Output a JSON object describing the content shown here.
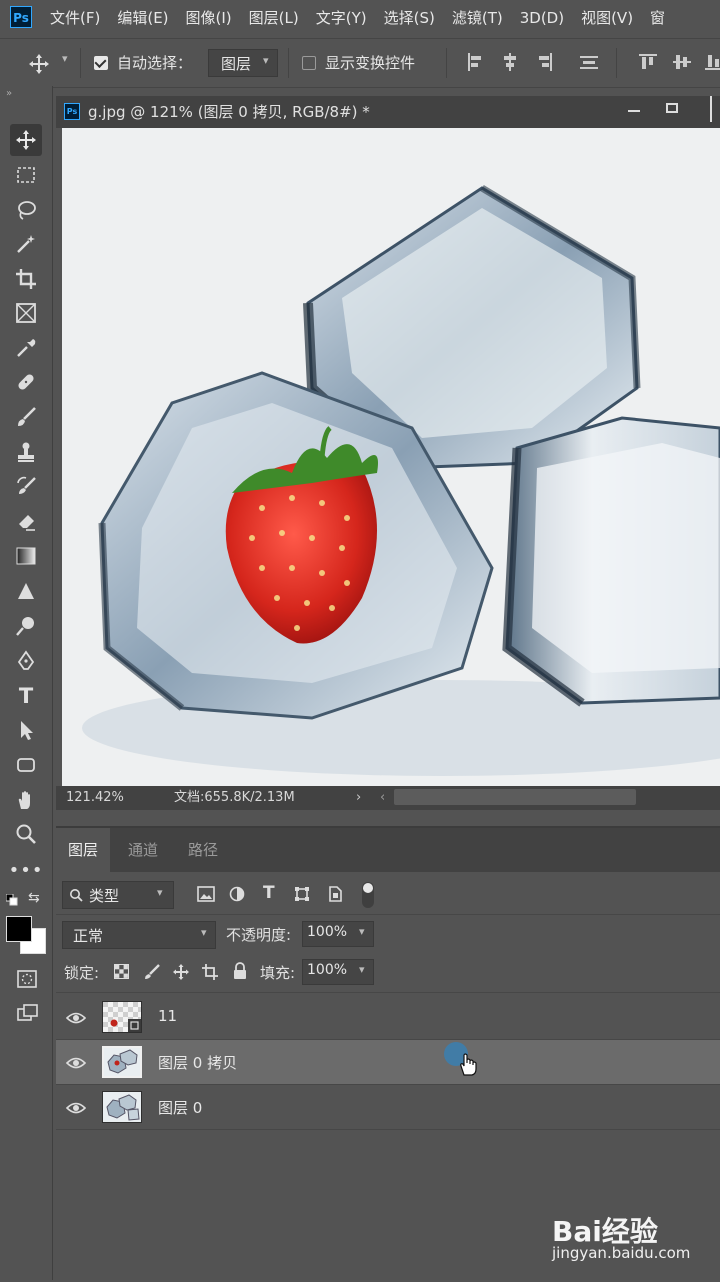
{
  "app": {
    "logo": "Ps"
  },
  "menu": [
    "文件(F)",
    "编辑(E)",
    "图像(I)",
    "图层(L)",
    "文字(Y)",
    "选择(S)",
    "滤镜(T)",
    "3D(D)",
    "视图(V)",
    "窗"
  ],
  "options": {
    "auto_select_label": "自动选择：",
    "auto_select_checked": true,
    "auto_select_target": "图层",
    "show_transform_label": "显示变换控件",
    "show_transform_checked": false
  },
  "document": {
    "title": "g.jpg @ 121% (图层 0 拷贝, RGB/8#) *",
    "zoom": "121.42%",
    "doc_info": "文档:655.8K/2.13M"
  },
  "panel": {
    "tabs": [
      "图层",
      "通道",
      "路径"
    ],
    "active_tab": 0,
    "filter_kind": "类型",
    "blend_mode": "正常",
    "opacity_label": "不透明度:",
    "opacity_value": "100%",
    "lock_label": "锁定:",
    "fill_label": "填充:",
    "fill_value": "100%",
    "layers": [
      {
        "name": "11",
        "visible": true,
        "selected": false
      },
      {
        "name": "图层 0 拷贝",
        "visible": true,
        "selected": true
      },
      {
        "name": "图层 0",
        "visible": true,
        "selected": false
      }
    ]
  },
  "icons": {
    "tools": [
      "move-icon",
      "marquee-icon",
      "lasso-icon",
      "magic-wand-icon",
      "crop-icon",
      "frame-icon",
      "eyedropper-icon",
      "healing-brush-icon",
      "brush-icon",
      "clone-stamp-icon",
      "history-brush-icon",
      "eraser-icon",
      "gradient-icon",
      "blur-icon",
      "dodge-icon",
      "pen-icon",
      "type-icon",
      "path-selection-icon",
      "rectangle-icon",
      "hand-icon",
      "zoom-icon",
      "more-icon"
    ]
  },
  "colors": {
    "foreground": "#000000",
    "background": "#ffffff",
    "accent": "#31a8ff"
  },
  "watermark": {
    "brand": "Bai经验",
    "url": "jingyan.baidu.com"
  }
}
